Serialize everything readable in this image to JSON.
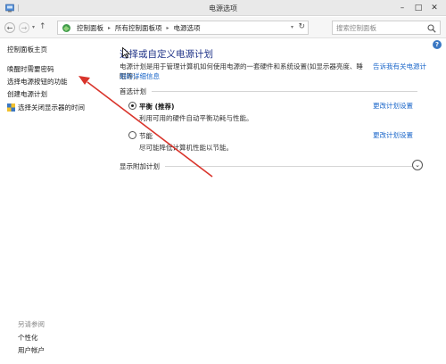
{
  "window": {
    "title": "电源选项"
  },
  "address_bar": {
    "breadcrumbs": [
      "控制面板",
      "所有控制面板项",
      "电源选项"
    ],
    "search_placeholder": "搜索控制面板"
  },
  "sidebar": {
    "home": "控制面板主页",
    "links": [
      "唤醒时需要密码",
      "选择电源按钮的功能",
      "创建电源计划",
      "选择关闭显示器的时间"
    ],
    "see_also_title": "另请参阅",
    "see_also": [
      "个性化",
      "用户帐户"
    ]
  },
  "main": {
    "title": "选择或自定义电源计划",
    "description": "电源计划是用于管理计算机如何使用电源的一套硬件和系统设置(如显示器亮度、睡眠等)。",
    "description_link": "划的详细信息",
    "tell_more_link": "告诉我有关电源计",
    "preferred_plans_header": "首选计划",
    "plans": [
      {
        "name": "平衡 (推荐)",
        "description": "利用可用的硬件自动平衡功耗与性能。",
        "selected": true,
        "change_link": "更改计划设置"
      },
      {
        "name": "节能",
        "description": "尽可能降低计算机性能以节能。",
        "selected": false,
        "change_link": "更改计划设置"
      }
    ],
    "additional_plans_header": "显示附加计划"
  },
  "colors": {
    "title_blue": "#1e3287",
    "link_blue": "#1a66c9",
    "annotation_red": "#d9342b"
  }
}
